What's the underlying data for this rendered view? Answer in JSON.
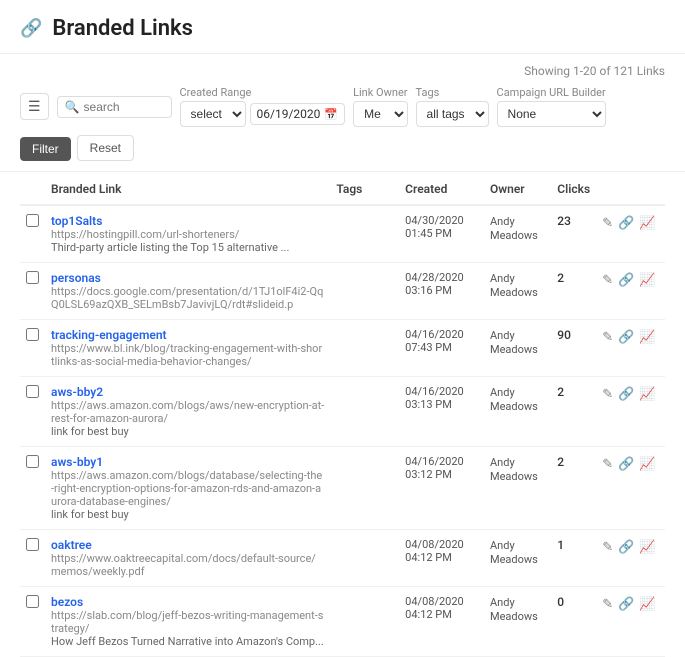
{
  "header": {
    "icon": "🔗",
    "title": "Branded Links"
  },
  "toolbar": {
    "showing": "Showing 1-20 of 121 Links",
    "filters": {
      "created_range_label": "Created Range",
      "search_placeholder": "search",
      "select_placeholder": "select",
      "date_value": "06/19/2020",
      "link_owner_label": "Link Owner",
      "link_owner_value": "Me",
      "tags_label": "Tags",
      "tags_value": "all tags",
      "campaign_label": "Campaign URL Builder",
      "campaign_value": "None",
      "filter_btn": "Filter",
      "reset_btn": "Reset"
    }
  },
  "table": {
    "columns": [
      "",
      "Branded Link",
      "Tags",
      "Created",
      "Owner",
      "Clicks",
      ""
    ],
    "rows": [
      {
        "id": 1,
        "name": "top1Salts",
        "url": "https://hostingpill.com/url-shorteners/",
        "desc": "Third-party article listing the Top 15 alternative ...",
        "tags": "",
        "created_date": "04/30/2020",
        "created_time": "01:45 PM",
        "owner": "Andy Meadows",
        "clicks": "23"
      },
      {
        "id": 2,
        "name": "personas",
        "url": "https://docs.google.com/presentation/d/1TJ1olF4i2-QqQ0LSL69azQXB_SELmBsb7JavivjLQ/rdt#slideid.p",
        "desc": "",
        "tags": "",
        "created_date": "04/28/2020",
        "created_time": "03:16 PM",
        "owner": "Andy Meadows",
        "clicks": "2"
      },
      {
        "id": 3,
        "name": "tracking-engagement",
        "url": "https://www.bl.ink/blog/tracking-engagement-with-shortlinks-as-social-media-behavior-changes/",
        "desc": "",
        "tags": "",
        "created_date": "04/16/2020",
        "created_time": "07:43 PM",
        "owner": "Andy Meadows",
        "clicks": "90"
      },
      {
        "id": 4,
        "name": "aws-bby2",
        "url": "https://aws.amazon.com/blogs/aws/new-encryption-at-rest-for-amazon-aurora/",
        "desc": "link for best buy",
        "tags": "",
        "created_date": "04/16/2020",
        "created_time": "03:13 PM",
        "owner": "Andy Meadows",
        "clicks": "2"
      },
      {
        "id": 5,
        "name": "aws-bby1",
        "url": "https://aws.amazon.com/blogs/database/selecting-the-right-encryption-options-for-amazon-rds-and-amazon-aurora-database-engines/",
        "desc": "link for best buy",
        "tags": "",
        "created_date": "04/16/2020",
        "created_time": "03:12 PM",
        "owner": "Andy Meadows",
        "clicks": "2"
      },
      {
        "id": 6,
        "name": "oaktree",
        "url": "https://www.oaktreecapital.com/docs/default-source/memos/weekly.pdf",
        "desc": "",
        "tags": "",
        "created_date": "04/08/2020",
        "created_time": "04:12 PM",
        "owner": "Andy Meadows",
        "clicks": "1"
      },
      {
        "id": 7,
        "name": "bezos",
        "url": "https://slab.com/blog/jeff-bezos-writing-management-strategy/",
        "desc": "How Jeff Bezos Turned Narrative into Amazon's Comp...",
        "tags": "",
        "created_date": "04/08/2020",
        "created_time": "04:12 PM",
        "owner": "Andy Meadows",
        "clicks": "0"
      }
    ]
  }
}
